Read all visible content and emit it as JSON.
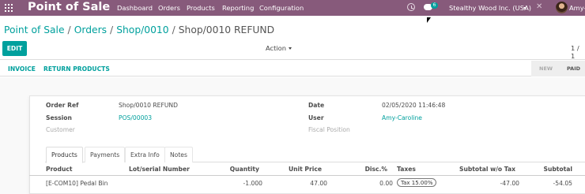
{
  "topbar": {
    "brand": "Point of Sale",
    "menu": [
      "Dashboard",
      "Orders",
      "Products",
      "Reporting",
      "Configuration"
    ],
    "chat_count": "6",
    "company": "Stealthy Wood Inc. (USA)",
    "user": "Amy-Caroline",
    "accent": "#875a7b"
  },
  "breadcrumb": {
    "items": [
      "Point of Sale",
      "Orders",
      "Shop/0010"
    ],
    "current": "Shop/0010 REFUND"
  },
  "control": {
    "edit_label": "EDIT",
    "action_label": "Action",
    "pager": "1 / 1"
  },
  "statusbar": {
    "invoice_label": "INVOICE",
    "return_label": "RETURN PRODUCTS",
    "stages": [
      "NEW",
      "PAID"
    ],
    "active_stage": "PAID"
  },
  "form": {
    "order_ref_label": "Order Ref",
    "order_ref": "Shop/0010 REFUND",
    "session_label": "Session",
    "session": "POS/00003",
    "customer_label": "Customer",
    "date_label": "Date",
    "date": "02/05/2020 11:46:48",
    "user_label": "User",
    "user": "Amy-Caroline",
    "fiscal_label": "Fiscal Position"
  },
  "tabs": [
    "Products",
    "Payments",
    "Extra Info",
    "Notes"
  ],
  "table": {
    "headers": [
      "Product",
      "Lot/serial Number",
      "Quantity",
      "Unit Price",
      "Disc.%",
      "Taxes",
      "Subtotal w/o Tax",
      "Subtotal"
    ],
    "rows": [
      {
        "product": "[E-COM10] Pedal Bin",
        "lot": "",
        "quantity": "-1.000",
        "unit_price": "47.00",
        "discount": "0.00",
        "taxes": "Tax 15.00%",
        "subtotal_wo_tax": "-47.00",
        "subtotal": "-54.05"
      }
    ]
  },
  "colors": {
    "primary": "#00a09d",
    "topbar": "#875a7b"
  }
}
